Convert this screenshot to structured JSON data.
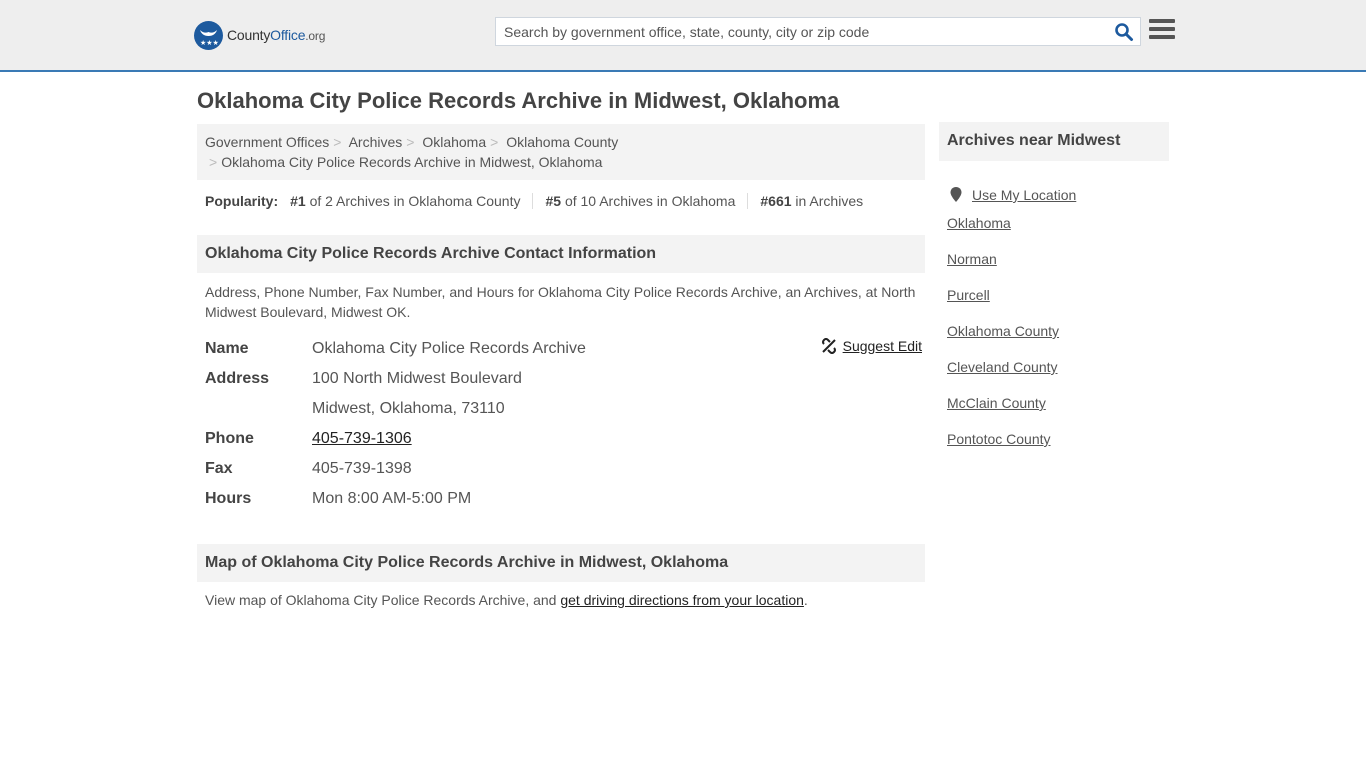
{
  "header": {
    "logo": {
      "brand_a": "County",
      "brand_b": "Office",
      "brand_c": ".org"
    },
    "search": {
      "placeholder": "Search by government office, state, county, city or zip code",
      "value": ""
    },
    "icons": {
      "search": "search-icon",
      "menu": "hamburger-menu-icon"
    }
  },
  "page": {
    "title": "Oklahoma City Police Records Archive in Midwest, Oklahoma"
  },
  "breadcrumb": {
    "items": [
      "Government Offices",
      "Archives",
      "Oklahoma",
      "Oklahoma County"
    ],
    "current": "Oklahoma City Police Records Archive in Midwest, Oklahoma",
    "separator": ">"
  },
  "popularity": {
    "label": "Popularity:",
    "items": [
      {
        "rank": "#1",
        "text": " of 2 Archives in Oklahoma County"
      },
      {
        "rank": "#5",
        "text": " of 10 Archives in Oklahoma"
      },
      {
        "rank": "#661",
        "text": " in Archives"
      }
    ]
  },
  "contact": {
    "heading": "Oklahoma City Police Records Archive Contact Information",
    "description": "Address, Phone Number, Fax Number, and Hours for Oklahoma City Police Records Archive, an Archives, at North Midwest Boulevard, Midwest OK.",
    "suggest_edit": "Suggest Edit",
    "fields": {
      "name_label": "Name",
      "name": "Oklahoma City Police Records Archive",
      "address_label": "Address",
      "address_line1": "100 North Midwest Boulevard",
      "address_line2": "Midwest, Oklahoma, 73110",
      "phone_label": "Phone",
      "phone": "405-739-1306",
      "fax_label": "Fax",
      "fax": "405-739-1398",
      "hours_label": "Hours",
      "hours": "Mon 8:00 AM-5:00 PM"
    }
  },
  "map": {
    "heading": "Map of Oklahoma City Police Records Archive in Midwest, Oklahoma",
    "text_before": "View map of Oklahoma City Police Records Archive, and ",
    "link": "get driving directions from your location",
    "text_after": "."
  },
  "sidebar": {
    "heading": "Archives near Midwest",
    "use_location": "Use My Location",
    "links": [
      "Oklahoma",
      "Norman",
      "Purcell",
      "Oklahoma County",
      "Cleveland County",
      "McClain County",
      "Pontotoc County"
    ]
  },
  "colors": {
    "brand_blue": "#1d5a9e",
    "accent_border": "#3a7ab5",
    "panel_bg": "#f3f3f3",
    "topbar_bg": "#eeeeee"
  }
}
